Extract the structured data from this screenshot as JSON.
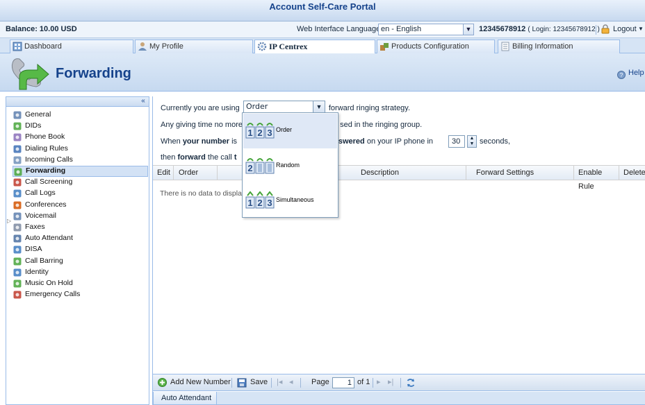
{
  "header": {
    "title": "Account Self-Care Portal",
    "balance": "Balance: 10.00 USD",
    "language_label": "Web Interface Language:",
    "language_value": "en - English",
    "account_number": "12345678912",
    "account_login": "( Login: 12345678912 )",
    "logout_label": "Logout"
  },
  "tabs": [
    {
      "label": "Dashboard",
      "icon": "dashboard-icon"
    },
    {
      "label": "My Profile",
      "icon": "user-icon"
    },
    {
      "label": "IP Centrex",
      "icon": "gear-icon",
      "active": true
    },
    {
      "label": "Products Configuration",
      "icon": "products-icon"
    },
    {
      "label": "Billing Information",
      "icon": "document-icon"
    }
  ],
  "page": {
    "title": "Forwarding",
    "help_label": "Help"
  },
  "sidebar": {
    "collapse_label": "«",
    "items": [
      {
        "label": "General",
        "icon": "gear-icon"
      },
      {
        "label": "DIDs",
        "icon": "dids-icon"
      },
      {
        "label": "Phone Book",
        "icon": "phone-book-icon"
      },
      {
        "label": "Dialing Rules",
        "icon": "dialing-rules-icon"
      },
      {
        "label": "Incoming Calls",
        "icon": "incoming-calls-icon"
      },
      {
        "label": "Forwarding",
        "icon": "forwarding-icon",
        "selected": true
      },
      {
        "label": "Call Screening",
        "icon": "call-screening-icon"
      },
      {
        "label": "Call Logs",
        "icon": "call-logs-icon"
      },
      {
        "label": "Conferences",
        "icon": "conferences-icon"
      },
      {
        "label": "Voicemail",
        "icon": "voicemail-icon"
      },
      {
        "label": "Faxes",
        "icon": "fax-icon"
      },
      {
        "label": "Auto Attendant",
        "icon": "auto-attendant-icon"
      },
      {
        "label": "DISA",
        "icon": "disa-icon"
      },
      {
        "label": "Call Barring",
        "icon": "call-barring-icon"
      },
      {
        "label": "Identity",
        "icon": "identity-icon"
      },
      {
        "label": "Music On Hold",
        "icon": "music-icon"
      },
      {
        "label": "Emergency Calls",
        "icon": "emergency-icon"
      }
    ]
  },
  "form": {
    "line1_prefix": "Currently you are using",
    "strategy_value": "Order",
    "line1_suffix": "forward ringing strategy.",
    "line2_prefix": "Any giving time no more",
    "line2_suffix": "sed in the ringing group.",
    "line3_a": "When",
    "line3_b": "your number",
    "line3_c": "is",
    "line3_d": "nswered",
    "line3_e": "on your IP phone in",
    "seconds_value": "30",
    "line3_f": "seconds,",
    "line4_a": "then",
    "line4_b": "forward",
    "line4_c": "the call",
    "line4_d": "t"
  },
  "strategy_options": [
    {
      "label": "Order",
      "icon": "order-icon",
      "highlighted": true
    },
    {
      "label": "Random",
      "icon": "random-icon"
    },
    {
      "label": "Simultaneous",
      "icon": "simultaneous-icon"
    }
  ],
  "grid": {
    "columns": [
      "Edit",
      "Order",
      "Description",
      "Forward Settings",
      "Enable Rule",
      "Delete"
    ],
    "empty_text": "There is no data to display"
  },
  "toolbar": {
    "add_label": "Add New Number",
    "save_label": "Save",
    "page_label": "Page",
    "page_value": "1",
    "of_label": "of 1"
  },
  "subtab": {
    "label": "Auto Attendant"
  },
  "colors": {
    "accent": "#15428b",
    "border": "#99bbe8",
    "selected_bg": "#d3e2f5"
  }
}
